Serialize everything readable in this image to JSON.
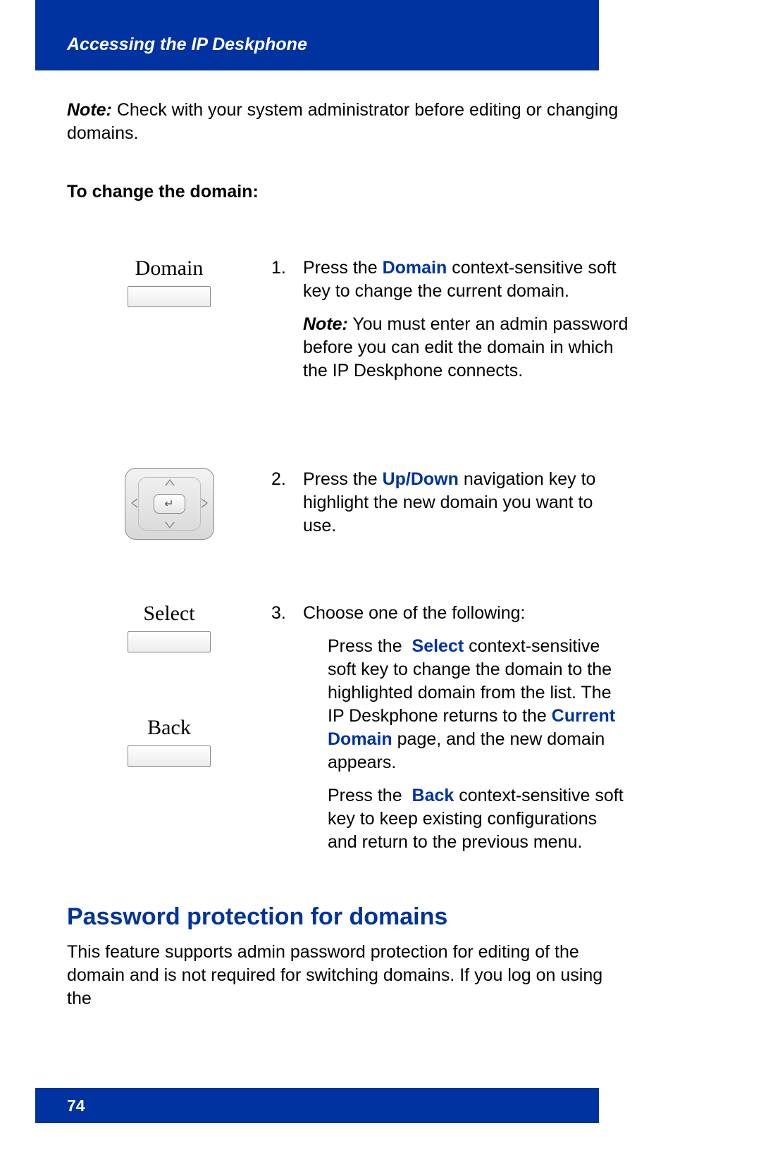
{
  "header": {
    "title": "Accessing the IP Deskphone"
  },
  "note": {
    "label": "Note:",
    "text": "Check with your system administrator before editing or changing domains."
  },
  "instruction_heading": "To change the domain:",
  "steps": {
    "s1": {
      "num": "1.",
      "softkey_label": "Domain",
      "text_pre": "Press the ",
      "kw": "Domain",
      "text_post": " context-sensitive soft key to change the current domain.",
      "note_label": "Note:",
      "note_text": "You must enter an admin password before you can edit the domain in which the IP Deskphone connects."
    },
    "s2": {
      "num": "2.",
      "text_pre": "Press the ",
      "kw": "Up/Down",
      "text_post": " navigation key to highlight the new domain you want to use."
    },
    "s3": {
      "num": "3.",
      "softkey_a_label": "Select",
      "softkey_b_label": "Back",
      "lead": "Choose one of the following:",
      "opt_a_pre": "Press the ",
      "opt_a_kw1": "Select",
      "opt_a_mid": " context-sensitive soft key to change the domain to the highlighted domain from the list. The IP Deskphone returns to the ",
      "opt_a_kw2": "Current Domain",
      "opt_a_post": " page, and the new domain appears.",
      "opt_b_pre": "Press the ",
      "opt_b_kw": "Back",
      "opt_b_post": " context-sensitive soft key to keep existing configurations and return to the previous menu."
    }
  },
  "section": {
    "heading": "Password protection for domains",
    "body": "This feature supports admin password protection for editing of the domain and is not required for switching domains. If you log on using the"
  },
  "footer": {
    "page_number": "74"
  }
}
